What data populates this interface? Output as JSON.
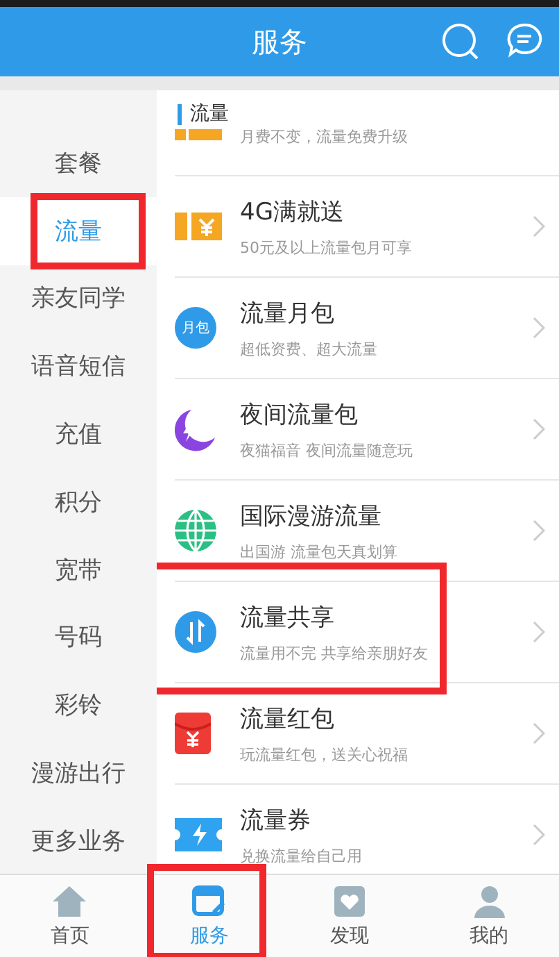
{
  "header": {
    "title": "服务"
  },
  "sidebar": {
    "items": [
      {
        "label": "套餐",
        "selected": false,
        "highlighted": false
      },
      {
        "label": "流量",
        "selected": true,
        "highlighted": true
      },
      {
        "label": "亲友同学",
        "selected": false,
        "highlighted": false
      },
      {
        "label": "语音短信",
        "selected": false,
        "highlighted": false
      },
      {
        "label": "充值",
        "selected": false,
        "highlighted": false
      },
      {
        "label": "积分",
        "selected": false,
        "highlighted": false
      },
      {
        "label": "宽带",
        "selected": false,
        "highlighted": false
      },
      {
        "label": "号码",
        "selected": false,
        "highlighted": false
      },
      {
        "label": "彩铃",
        "selected": false,
        "highlighted": false
      },
      {
        "label": "漫游出行",
        "selected": false,
        "highlighted": false
      },
      {
        "label": "更多业务",
        "selected": false,
        "highlighted": false
      }
    ]
  },
  "section": {
    "title": "流量"
  },
  "services": [
    {
      "kind": "partial",
      "subtitle": "月费不变，流量免费升级",
      "highlighted": false
    },
    {
      "kind": "full",
      "title": "4G满就送",
      "subtitle": "50元及以上流量包月可享",
      "highlighted": false
    },
    {
      "kind": "full",
      "title": "流量月包",
      "subtitle": "超低资费、超大流量",
      "icon_text": "月包",
      "highlighted": false
    },
    {
      "kind": "full",
      "title": "夜间流量包",
      "subtitle": "夜猫福音 夜间流量随意玩",
      "highlighted": false
    },
    {
      "kind": "full",
      "title": "国际漫游流量",
      "subtitle": "出国游 流量包天真划算",
      "highlighted": false
    },
    {
      "kind": "full",
      "title": "流量共享",
      "subtitle": "流量用不完 共享给亲朋好友",
      "highlighted": true
    },
    {
      "kind": "full",
      "title": "流量红包",
      "subtitle": "玩流量红包，送关心祝福",
      "highlighted": false
    },
    {
      "kind": "full",
      "title": "流量券",
      "subtitle": "兑换流量给自己用",
      "highlighted": false
    }
  ],
  "tab_bar": [
    {
      "label": "首页",
      "selected": false,
      "highlighted": false
    },
    {
      "label": "服务",
      "selected": true,
      "highlighted": true
    },
    {
      "label": "发现",
      "selected": false,
      "highlighted": false
    },
    {
      "label": "我的",
      "selected": false,
      "highlighted": false
    }
  ]
}
